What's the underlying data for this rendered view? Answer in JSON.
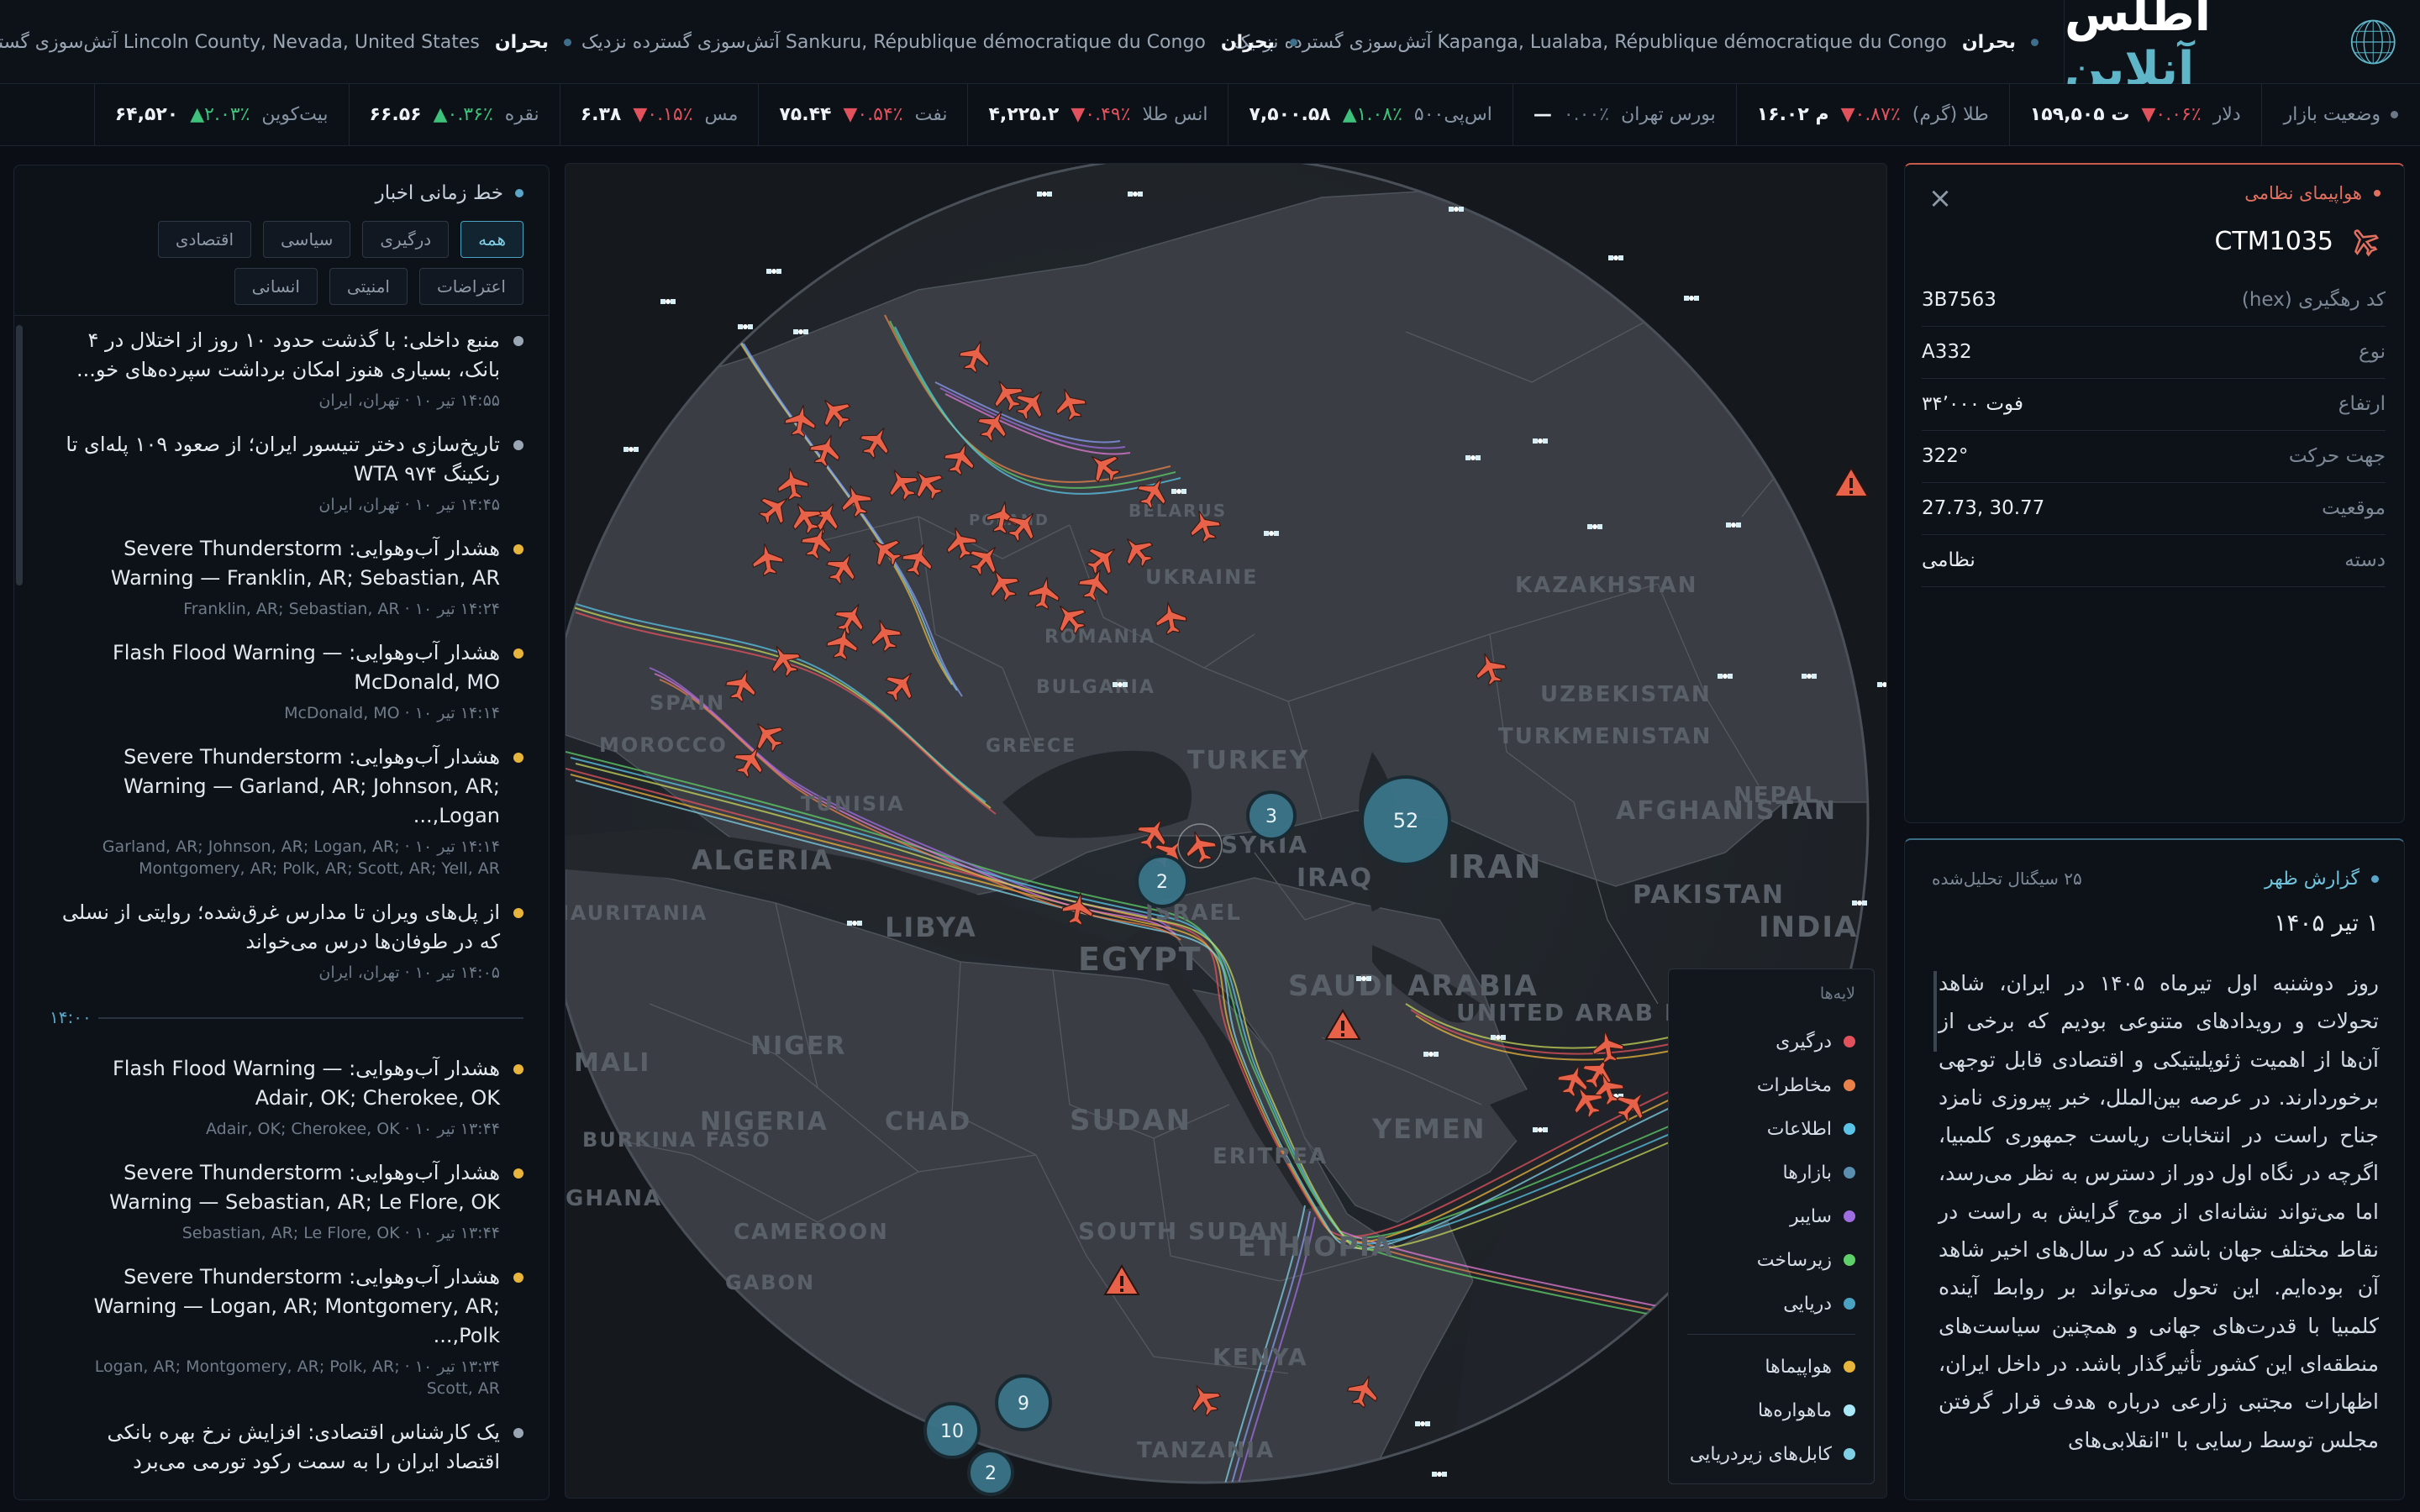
{
  "brand": {
    "part1": "اطلس",
    "part2": "آنلاین"
  },
  "ticker": [
    {
      "tag": "بحران",
      "text": "آتش‌سوزی گسترده نزدیک Kapanga, Lualaba, République démocratique du Congo"
    },
    {
      "tag": "بحران",
      "text": "آتش‌سوزی گسترده نزدیک Sankuru, République démocratique du Congo"
    },
    {
      "tag": "بحران",
      "text": "آتش‌سوزی گسترده نزدیک Lincoln County, Nevada, United States"
    }
  ],
  "market": {
    "label": "وضعیت بازار",
    "items": [
      {
        "name": "دلار",
        "change": "▼۰.۰۶٪",
        "dir": "dn",
        "value": "۱۵۹,۵۰۵ ت"
      },
      {
        "name": "طلا (گرم)",
        "change": "▼۰.۸۷٪",
        "dir": "dn",
        "value": "۱۶.۰۲ م"
      },
      {
        "name": "بورس تهران",
        "change": "۰.۰۰٪",
        "dir": "fl",
        "value": "—"
      },
      {
        "name": "اس‌پی۵۰۰",
        "change": "▲۱.۰۸٪",
        "dir": "up",
        "value": "۷,۵۰۰.۵۸"
      },
      {
        "name": "انس طلا",
        "change": "▼۰.۴۹٪",
        "dir": "dn",
        "value": "۴,۲۲۵.۲"
      },
      {
        "name": "نفت",
        "change": "▼۰.۵۴٪",
        "dir": "dn",
        "value": "۷۵.۴۴"
      },
      {
        "name": "مس",
        "change": "▼۰.۱۵٪",
        "dir": "dn",
        "value": "۶.۳۸"
      },
      {
        "name": "نقره",
        "change": "▲۰.۳۶٪",
        "dir": "up",
        "value": "۶۶.۵۶"
      },
      {
        "name": "بیت‌کوین",
        "change": "▲۲.۰۳٪",
        "dir": "up",
        "value": "۶۴,۵۲۰"
      }
    ]
  },
  "news": {
    "title": "خط زمانی اخبار",
    "filters": [
      "همه",
      "درگیری",
      "سیاسی",
      "اقتصادی",
      "اعتراضات",
      "امنیتی",
      "انسانی"
    ],
    "items_a": [
      {
        "title": "منبع داخلی: با گذشت حدود ۱۰ روز از اختلال در ۴ بانک، بسیاری هنوز امکان برداشت سپرده‌های خو...",
        "meta": "۱۴:۵۵ تیر ۱۰ · تهران، ایران",
        "color": "#9aa6b4"
      },
      {
        "title": "تاریخ‌سازی دختر تنیسور ایران؛ از صعود ۱۰۹ پله‌ای تا رنکینگ WTA ۹۷۴",
        "meta": "۱۴:۴۵ تیر ۱۰ · تهران، ایران",
        "color": "#9aa6b4"
      },
      {
        "title": "هشدار آب‌وهوایی: Severe Thunderstorm Warning — Franklin, AR; Sebastian, AR",
        "meta": "۱۴:۲۴ تیر ۱۰ · Franklin, AR; Sebastian, AR",
        "color": "#e8b53c"
      },
      {
        "title": "هشدار آب‌وهوایی: Flash Flood Warning — McDonald, MO",
        "meta": "۱۴:۱۴ تیر ۱۰ · McDonald, MO",
        "color": "#e8b53c"
      },
      {
        "title": "هشدار آب‌وهوایی: Severe Thunderstorm Warning — Garland, AR; Johnson, AR; Logan,...",
        "meta": "۱۴:۱۴ تیر ۱۰ · Garland, AR; Johnson, AR; Logan, AR; Montgomery, AR; Polk, AR; Scott, AR; Yell, AR",
        "color": "#e8b53c"
      },
      {
        "title": "از پل‌های ویران تا مدارس غرق‌شده؛ روایتی از نسلی که در طوفان‌ها درس می‌خواند",
        "meta": "۱۴:۰۵ تیر ۱۰ · تهران، ایران",
        "color": "#e8b53c"
      }
    ],
    "separator": "۱۴:۰۰",
    "items_b": [
      {
        "title": "هشدار آب‌وهوایی: Flash Flood Warning — Adair, OK; Cherokee, OK",
        "meta": "۱۳:۴۴ تیر ۱۰ · Adair, OK; Cherokee, OK",
        "color": "#e8b53c"
      },
      {
        "title": "هشدار آب‌وهوایی: Severe Thunderstorm Warning — Sebastian, AR; Le Flore, OK",
        "meta": "۱۳:۴۴ تیر ۱۰ · Sebastian, AR; Le Flore, OK",
        "color": "#e8b53c"
      },
      {
        "title": "هشدار آب‌وهوایی: Severe Thunderstorm Warning — Logan, AR; Montgomery, AR; Polk,...",
        "meta": "۱۳:۳۴ تیر ۱۰ · Logan, AR; Montgomery, AR; Polk, AR; Scott, AR",
        "color": "#e8b53c"
      },
      {
        "title": "یک کارشناس اقتصادی: افزایش نرخ بهره بانکی اقتصاد ایران را به سمت رکود تورمی می‌برد",
        "meta": "",
        "color": "#9aa6b4"
      }
    ]
  },
  "map": {
    "countries": [
      "BELARUS",
      "POLAND",
      "UKRAINE",
      "ROMANIA",
      "BULGARIA",
      "GREECE",
      "TURKEY",
      "SYRIA",
      "IRAQ",
      "IRAN",
      "ISRAEL",
      "EGYPT",
      "LIBYA",
      "ALGERIA",
      "TUNISIA",
      "MOROCCO",
      "SAUDI ARABIA",
      "UNITED ARAB EMIRATES",
      "YEMEN",
      "SUDAN",
      "SOUTH SUDAN",
      "ETHIOPIA",
      "ERITREA",
      "KENYA",
      "TANZANIA",
      "CHAD",
      "NIGER",
      "NIGERIA",
      "MALI",
      "CAMEROON",
      "GABON",
      "GHANA",
      "BURKINA FASO",
      "KAZAKHSTAN",
      "UZBEKISTAN",
      "TURKMENISTAN",
      "AFGHANISTAN",
      "PAKISTAN",
      "NEPAL",
      "INDIA",
      "MAURITANIA",
      "SPAIN"
    ],
    "clusters": [
      "52",
      "3",
      "2",
      "9",
      "10",
      "2"
    ]
  },
  "legend": {
    "title": "لایه‌ها",
    "layers": [
      {
        "label": "درگیری",
        "color": "#e2525c"
      },
      {
        "label": "مخاطرات",
        "color": "#e8824a"
      },
      {
        "label": "اطلاعات",
        "color": "#5bc4e6"
      },
      {
        "label": "بازارها",
        "color": "#5a8fb0"
      },
      {
        "label": "سایبر",
        "color": "#a06de0"
      },
      {
        "label": "زیرساخت",
        "color": "#5fcf6a"
      },
      {
        "label": "دریایی",
        "color": "#4aa3c0"
      }
    ],
    "layers2": [
      {
        "label": "هواپیماها",
        "color": "#e8b53c"
      },
      {
        "label": "ماهواره‌ها",
        "color": "#a8e8f8"
      },
      {
        "label": "کابل‌های زیردریایی",
        "color": "#7fd0e6"
      }
    ]
  },
  "aircraft": {
    "category": "هواپیمای نظامی",
    "callsign": "CTM1035",
    "rows": [
      {
        "k": "کد رهگیری (hex)",
        "v": "3B7563"
      },
      {
        "k": "نوع",
        "v": "A332"
      },
      {
        "k": "ارتفاع",
        "v": "۳۴٬۰۰۰ فوت"
      },
      {
        "k": "جهت حرکت",
        "v": "322°"
      },
      {
        "k": "موقعیت",
        "v": "27.73, 30.77"
      },
      {
        "k": "دسته",
        "v": "نظامی"
      }
    ]
  },
  "brief": {
    "title": "گزارش ظهر",
    "count": "۲۵ سیگنال تحلیل‌شده",
    "date": "۱ تیر ۱۴۰۵",
    "text": "روز دوشنبه اول تیرماه ۱۴۰۵ در ایران، شاهد تحولات و رویدادهای متنوعی بودیم که برخی از آن‌ها از اهمیت ژئوپلیتیکی و اقتصادی قابل توجهی برخوردارند. در عرصه بین‌الملل، خبر پیروزی نامزد جناح راست در انتخابات ریاست جمهوری کلمبیا، اگرچه در نگاه اول دور از دسترس به نظر می‌رسد، اما می‌تواند نشانه‌ای از موج گرایش به راست در نقاط مختلف جهان باشد که در سال‌های اخیر شاهد آن بوده‌ایم. این تحول می‌تواند بر روابط آینده کلمبیا با قدرت‌های جهانی و همچنین سیاست‌های منطقه‌ای این کشور تأثیرگذار باشد. در داخل ایران، اظهارات مجتبی زارعی درباره هدف قرار گرفتن مجلس توسط رسایی با \"انقلابی‌های"
  }
}
